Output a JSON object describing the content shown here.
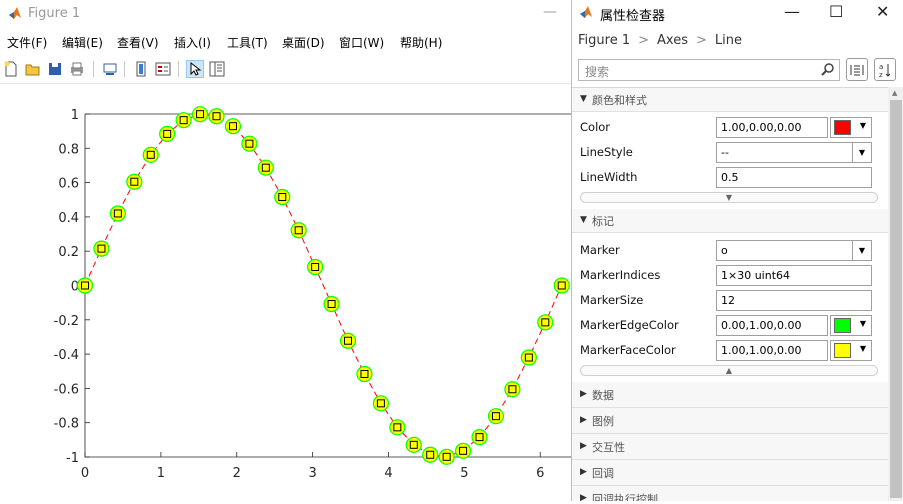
{
  "figure": {
    "title": "Figure 1",
    "minimize_symbol": "—",
    "menu": [
      "文件(F)",
      "编辑(E)",
      "查看(V)",
      "插入(I)",
      "工具(T)",
      "桌面(D)",
      "窗口(W)",
      "帮助(H)"
    ],
    "toolbar_icons": [
      "new-figure-icon",
      "open-file-icon",
      "save-icon",
      "print-icon",
      "link-plot-icon",
      "insert-colorbar-icon",
      "insert-legend-icon",
      "edit-plot-icon",
      "property-inspector-icon"
    ]
  },
  "inspector": {
    "title": "属性检查器",
    "window_controls": [
      "—",
      "☐",
      "✕"
    ],
    "breadcrumb": [
      "Figure 1",
      "Axes",
      "Line"
    ],
    "breadcrumb_sep": ">",
    "search_placeholder": "搜索",
    "sections": {
      "color_style": {
        "label": "颜色和样式",
        "rows": [
          {
            "name": "Color",
            "value": "1.00,0.00,0.00",
            "swatch": "#ff0000"
          },
          {
            "name": "LineStyle",
            "value": "--"
          },
          {
            "name": "LineWidth",
            "value": "0.5"
          }
        ]
      },
      "markers": {
        "label": "标记",
        "rows": [
          {
            "name": "Marker",
            "value": "o"
          },
          {
            "name": "MarkerIndices",
            "value": "1×30 uint64"
          },
          {
            "name": "MarkerSize",
            "value": "12"
          },
          {
            "name": "MarkerEdgeColor",
            "value": "0.00,1.00,0.00",
            "swatch": "#00ff00"
          },
          {
            "name": "MarkerFaceColor",
            "value": "1.00,1.00,0.00",
            "swatch": "#ffff00"
          }
        ]
      },
      "collapsed": [
        "数据",
        "图例",
        "交互性",
        "回调",
        "回调执行控制"
      ]
    }
  },
  "chart_data": {
    "type": "line",
    "title": "",
    "xlabel": "",
    "ylabel": "",
    "xlim": [
      0,
      6.3
    ],
    "ylim": [
      -1,
      1
    ],
    "xticks": [
      0,
      1,
      2,
      3,
      4,
      5,
      6
    ],
    "yticks": [
      -1,
      -0.8,
      -0.6,
      -0.4,
      -0.2,
      0,
      0.2,
      0.4,
      0.6,
      0.8,
      1
    ],
    "grid": false,
    "line_color": "#ff0000",
    "line_style": "--",
    "marker": "o",
    "marker_edge_color": "#00ff00",
    "marker_face_color": "#ffff00",
    "series": [
      {
        "x": [
          0,
          0.2167,
          0.4333,
          0.65,
          0.8666,
          1.0833,
          1.2999,
          1.5166,
          1.7333,
          1.9499,
          2.1666,
          2.3832,
          2.5999,
          2.8166,
          3.0332,
          3.2499,
          3.4665,
          3.6832,
          3.8999,
          4.1165,
          4.3332,
          4.5498,
          4.7665,
          4.9832,
          5.1998,
          5.4165,
          5.6331,
          5.8498,
          6.0665,
          6.2832
        ],
        "y": [
          0,
          0.215,
          0.42,
          0.605,
          0.762,
          0.884,
          0.964,
          0.999,
          0.987,
          0.929,
          0.827,
          0.687,
          0.516,
          0.322,
          0.108,
          -0.108,
          -0.322,
          -0.516,
          -0.687,
          -0.827,
          -0.929,
          -0.987,
          -0.999,
          -0.964,
          -0.884,
          -0.762,
          -0.605,
          -0.42,
          -0.215,
          0
        ]
      }
    ]
  }
}
